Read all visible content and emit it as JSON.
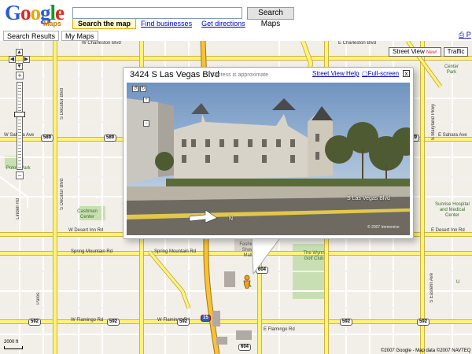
{
  "header": {
    "logo": "Google",
    "logo_sub": "Maps",
    "search_value": "",
    "search_button": "Search Maps",
    "tabs": [
      "Search the map",
      "Find businesses",
      "Get directions"
    ]
  },
  "side_tabs": [
    "Search Results",
    "My Maps"
  ],
  "print": "P",
  "map_types": {
    "street_view": "Street View",
    "street_view_badge": "New!",
    "traffic": "Traffic"
  },
  "bubble": {
    "title": "3424 S Las Vegas Blvd",
    "approx": "Address is approximate",
    "help": "Street View Help",
    "fullscreen": "Full-screen",
    "close": "x",
    "street_label": "S Las Vegas Blvd",
    "direction": "N",
    "photo_copyright": "© 2007 Immersive"
  },
  "roads": {
    "charleston_w": "W Charleston Blvd",
    "charleston_e": "E Charleston Blvd",
    "sahara_w": "W Sahara Ave",
    "sahara_e": "E Sahara Ave",
    "desert_inn_w": "W Desert Inn Rd",
    "desert_inn_e": "E Desert Inn Rd",
    "spring_mtn_w": "Spring Mountain Rd",
    "spring_mtn_e": "Spring Mountain Rd",
    "flamingo_w": "W Flamingo Rd",
    "flamingo_m": "W Flamingo Rd",
    "flamingo_e": "E Flamingo Rd",
    "decatur_n": "S Decatur Blvd",
    "decatur_s": "S Decatur Blvd",
    "lindell": "Lindell Rd",
    "maryland": "S Maryland Pkwy",
    "eastern": "S Eastern Ave",
    "palos": "Palos"
  },
  "shields": {
    "s589a": "589",
    "s589b": "589",
    "s589c": "589",
    "s589d": "589",
    "s604a": "604",
    "s604b": "604",
    "s592a": "592",
    "s592b": "592",
    "s592c": "592",
    "s592d": "592",
    "s592e": "592",
    "s15": "15"
  },
  "places": {
    "potosi": "Potosi Park",
    "cashman": "Cashman Center",
    "fashion": "Fashion Show Mall",
    "wynn": "The Wynn Golf Club",
    "sunrise": "Sunrise Hospital and Medical Center",
    "center": "Center Park",
    "u": "U"
  },
  "scale": "2000 ft",
  "copyright": "©2007 Google - Map data ©2007 NAVTEQ"
}
